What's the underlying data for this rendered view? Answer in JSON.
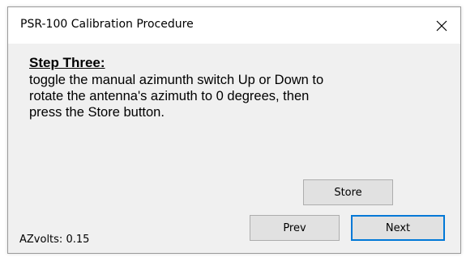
{
  "window": {
    "title": "PSR-100 Calibration Procedure",
    "close_icon": "close-icon"
  },
  "instructions": {
    "heading": "Step Three:",
    "body": "toggle the manual azimunth switch Up or Down to rotate the antenna's azimuth to 0 degrees, then press the Store button."
  },
  "buttons": {
    "store_label": "Store",
    "prev_label": "Prev",
    "next_label": "Next"
  },
  "status": {
    "az_volts_text": "AZvolts: 0.15"
  },
  "colors": {
    "focus_border": "#0078d7",
    "dialog_background": "#f0f0f0",
    "titlebar_background": "#ffffff",
    "button_background": "#e1e1e1"
  }
}
